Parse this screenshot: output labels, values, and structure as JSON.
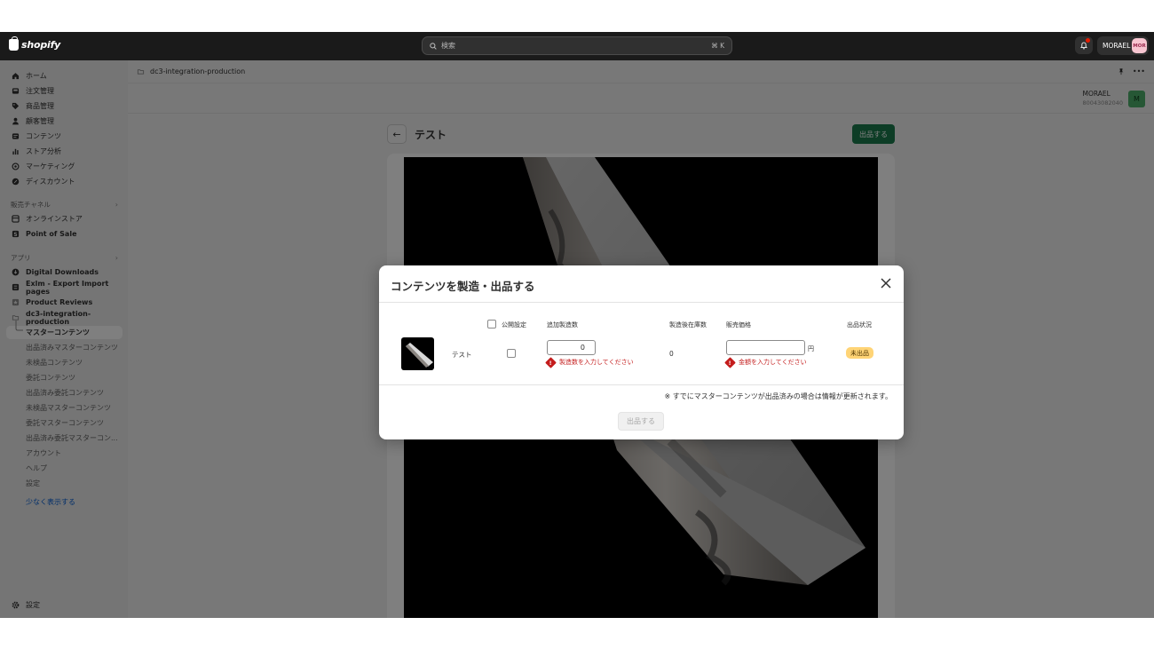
{
  "topbar": {
    "brand": "shopify",
    "search_placeholder": "検索",
    "search_shortcut": "⌘ K",
    "store_name": "MORAEL",
    "store_avatar": "MOR"
  },
  "sidebar": {
    "main": [
      {
        "label": "ホーム",
        "icon": "home-icon"
      },
      {
        "label": "注文管理",
        "icon": "inbox-icon"
      },
      {
        "label": "商品管理",
        "icon": "tag-icon"
      },
      {
        "label": "顧客管理",
        "icon": "person-icon"
      },
      {
        "label": "コンテンツ",
        "icon": "content-icon"
      },
      {
        "label": "ストア分析",
        "icon": "chart-icon"
      },
      {
        "label": "マーケティング",
        "icon": "target-icon"
      },
      {
        "label": "ディスカウント",
        "icon": "discount-icon"
      }
    ],
    "channels_heading": "販売チャネル",
    "channels": [
      {
        "label": "オンラインストア",
        "icon": "store-icon"
      },
      {
        "label": "Point of Sale",
        "icon": "pos-icon"
      }
    ],
    "apps_heading": "アプリ",
    "apps": [
      {
        "label": "Digital Downloads"
      },
      {
        "label": "Exlm - Export Import pages"
      },
      {
        "label": "Product Reviews"
      },
      {
        "label": "dc3-integration-production"
      }
    ],
    "subitems": [
      "マスターコンテンツ",
      "出品済みマスターコンテンツ",
      "未検品コンテンツ",
      "委託コンテンツ",
      "出品済み委託コンテンツ",
      "未検品マスターコンテンツ",
      "委託マスターコンテンツ",
      "出品済み委託マスターコン...",
      "アカウント",
      "ヘルプ",
      "設定"
    ],
    "show_less": "少なく表示する",
    "settings": "設定"
  },
  "appbar": {
    "app_name": "dc3-integration-production"
  },
  "account": {
    "name": "MORAEL",
    "id": "80043082040",
    "avatar": "M"
  },
  "page": {
    "title": "テスト",
    "publish_button": "出品する"
  },
  "modal": {
    "title": "コンテンツを製造・出品する",
    "headers": {
      "public": "公開設定",
      "add_qty": "追加製造数",
      "stock_after": "製造後在庫数",
      "price": "販売価格",
      "status": "出品状況"
    },
    "row": {
      "name": "テスト",
      "add_qty_value": "0",
      "add_qty_error": "製造数を入力してください",
      "stock_after": "0",
      "price_value": "",
      "price_unit": "円",
      "price_error": "金額を入力してください",
      "status_badge": "未出品"
    },
    "note": "※ すでにマスターコンテンツが出品済みの場合は情報が更新されます。",
    "submit": "出品する"
  },
  "colors": {
    "primary_button": "#1a7a4c",
    "error": "#c41c1c",
    "badge": "#ffd476"
  }
}
